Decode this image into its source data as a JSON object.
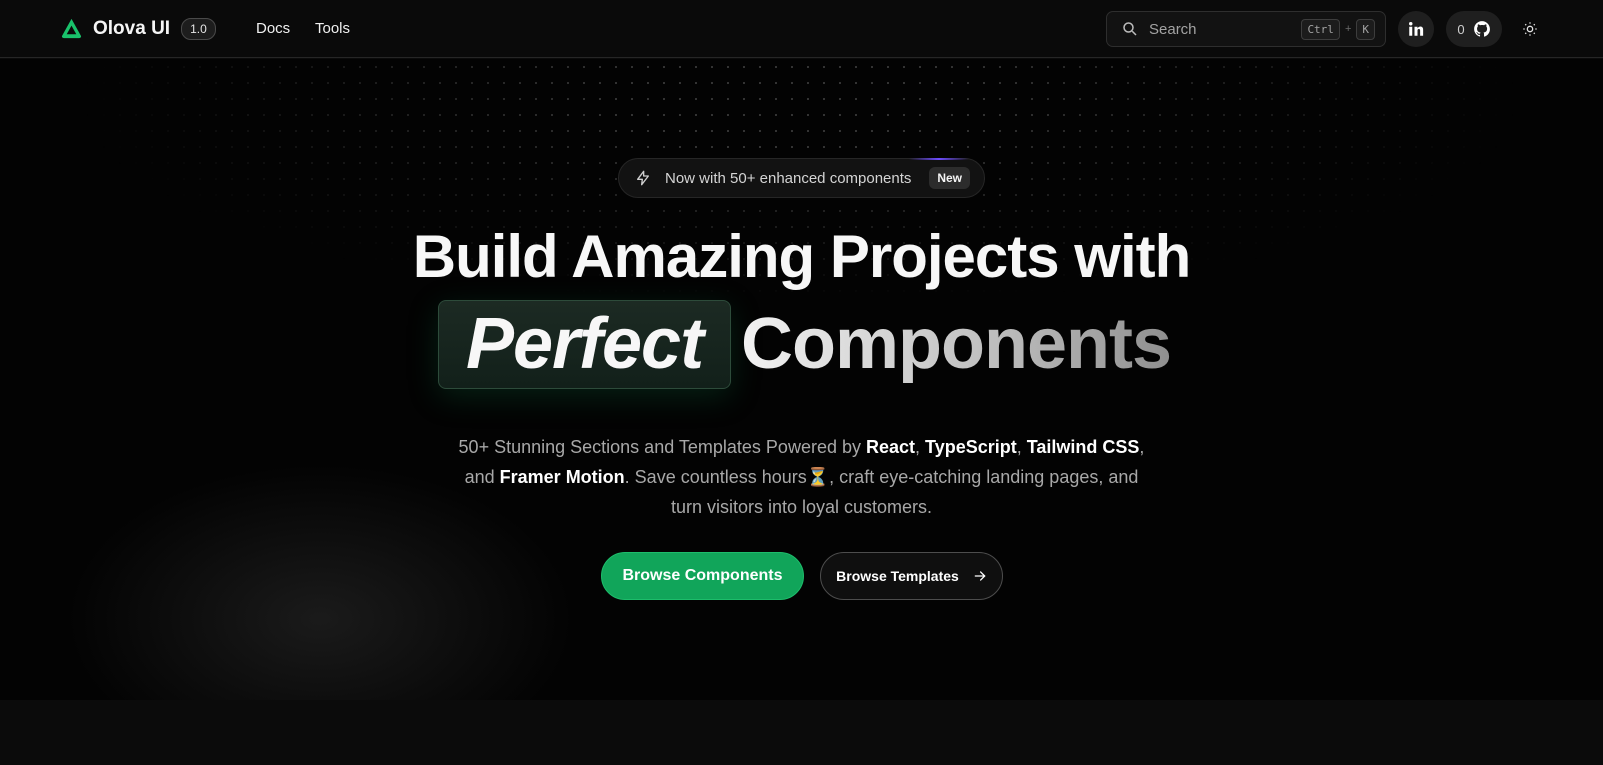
{
  "header": {
    "logo_text": "Olova UI",
    "version": "1.0",
    "nav": [
      {
        "label": "Docs"
      },
      {
        "label": "Tools"
      }
    ],
    "search": {
      "placeholder": "Search",
      "shortcut_key_1": "Ctrl",
      "shortcut_plus": "+",
      "shortcut_key_2": "K"
    },
    "github_stars": "0",
    "icons": [
      "logo-icon",
      "search-icon",
      "linkedin-icon",
      "github-icon",
      "sun-icon"
    ]
  },
  "hero": {
    "announcement": {
      "text": "Now with 50+ enhanced components",
      "badge": "New"
    },
    "headline_line1": "Build Amazing Projects with",
    "headline_highlight": "Perfect",
    "headline_rest": "Components",
    "subtext": {
      "part1": "50+ Stunning Sections and Templates Powered by ",
      "react": "React",
      "comma1": ", ",
      "typescript": "TypeScript",
      "comma2": ", ",
      "tailwind": "Tailwind CSS",
      "and": ", and ",
      "framer": "Framer Motion",
      "part2": ". Save countless hours⏳, craft eye-catching landing pages, and turn visitors into loyal customers."
    },
    "primary_button": "Browse Components",
    "secondary_button": "Browse Templates"
  },
  "colors": {
    "accent": "#11a55a",
    "background": "#030303",
    "header_bg": "#0a0a0a"
  }
}
